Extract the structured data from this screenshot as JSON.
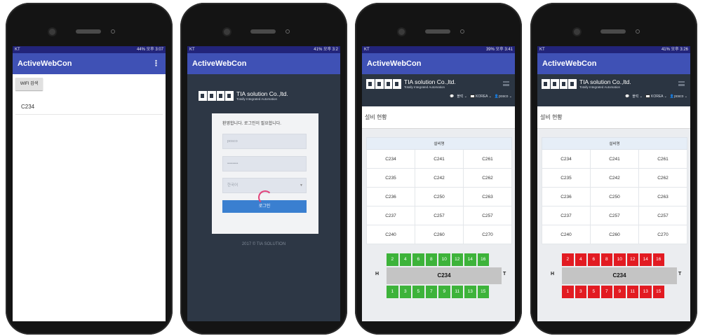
{
  "statusbar": {
    "s1": {
      "carrier": "KT",
      "right": "44% 오후 3:07"
    },
    "s2": {
      "carrier": "KT",
      "right": "41% 오후 3:2"
    },
    "s3": {
      "carrier": "KT",
      "right": "39% 오후 3:41"
    },
    "s4": {
      "carrier": "KT",
      "right": "41% 오후 3:26"
    }
  },
  "app": {
    "title": "ActiveWebCon",
    "menu_icon": "more-vert-icon"
  },
  "screen1": {
    "wifi_button": "WIFI 검색",
    "list": [
      "C234"
    ]
  },
  "screen2": {
    "company_name": "TIA solution Co.,ltd.",
    "company_tagline": "Totally Integrated Automation",
    "welcome": "환영합니다. 로그인이 필요합니다.",
    "username_value": "posco",
    "password_value": "••••••••",
    "language_value": "한국어",
    "login_button": "로그인",
    "copyright": "2017 © TIA SOLUTION"
  },
  "site": {
    "company_name": "TIA solution Co.,ltd.",
    "company_tagline": "Totally Integrated Automation",
    "menu_lang": "KOREA",
    "menu_user": "posco",
    "menu_board": "블럭",
    "section_title": "설비 현황",
    "table_header": "설비명",
    "table_rows": [
      [
        "C234",
        "C241",
        "C261"
      ],
      [
        "C235",
        "C242",
        "C262"
      ],
      [
        "C236",
        "C250",
        "C263"
      ],
      [
        "C237",
        "C257",
        "C257"
      ],
      [
        "C240",
        "C260",
        "C270"
      ]
    ]
  },
  "rack": {
    "left_label": "H",
    "right_label": "T",
    "name": "C234",
    "top_cells": [
      "2",
      "4",
      "6",
      "8",
      "10",
      "12",
      "14",
      "16"
    ],
    "bottom_cells": [
      "1",
      "3",
      "5",
      "7",
      "9",
      "11",
      "13",
      "15"
    ],
    "colors": {
      "ok": "#3db33a",
      "alarm": "#e21b22"
    }
  }
}
